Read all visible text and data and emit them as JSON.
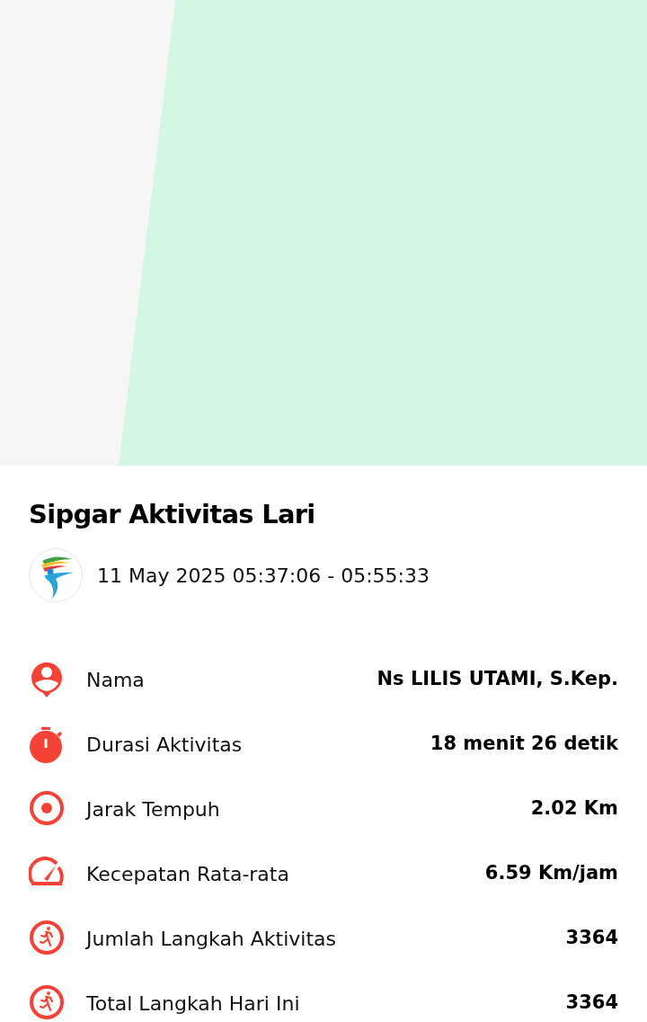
{
  "title": "Sipgar Aktivitas Lari",
  "time_range": "11 May 2025 05:37:06 - 05:55:33",
  "stats": [
    {
      "kind": "person",
      "label": "Nama",
      "value": "Ns LILIS UTAMI, S.Kep."
    },
    {
      "kind": "stopwatch",
      "label": "Durasi Aktivitas",
      "value": "18 menit 26 detik"
    },
    {
      "kind": "target",
      "label": "Jarak Tempuh",
      "value": "2.02 Km"
    },
    {
      "kind": "speed",
      "label": "Kecepatan Rata-rata",
      "value": "6.59 Km/jam"
    },
    {
      "kind": "runner",
      "label": "Jumlah Langkah Aktivitas",
      "value": "3364"
    },
    {
      "kind": "runner",
      "label": "Total Langkah Hari Ini",
      "value": "3364"
    }
  ]
}
